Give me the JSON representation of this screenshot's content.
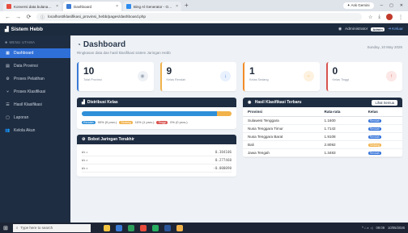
{
  "browser": {
    "tabs": [
      {
        "label": "Konversi data bulanan ke tahu",
        "fav_color": "#e74c3c",
        "active": false
      },
      {
        "label": "Dashboard",
        "fav_color": "#3a7bd5",
        "active": true
      },
      {
        "label": "Bing Al Generator - Online Harr",
        "fav_color": "#2d8cf0",
        "active": false
      }
    ],
    "ask_gemini": "Ask Gemini",
    "url": "localhost/klasifikasi_provinsi_hebb/pages/dashboard.php"
  },
  "app": {
    "brand": "Sistem Hebb",
    "user_name": "Administrator",
    "role_badge": "Admin",
    "logout": "Keluar"
  },
  "sidebar": {
    "heading": "MENU UTAMA",
    "items": [
      {
        "label": "Dashboard",
        "icon": "grid-icon",
        "glyph": "▦",
        "active": true
      },
      {
        "label": "Data Provinsi",
        "icon": "table-icon",
        "glyph": "▤"
      },
      {
        "label": "Proses Pelatihan",
        "icon": "cog-icon",
        "glyph": "⚙"
      },
      {
        "label": "Proses Klasifikasi",
        "icon": "branch-icon",
        "glyph": "⑂"
      },
      {
        "label": "Hasil Klasifikasi",
        "icon": "list-icon",
        "glyph": "☰"
      },
      {
        "label": "Laporan",
        "icon": "file-icon",
        "glyph": "▢"
      },
      {
        "label": "Kelola Akun",
        "icon": "users-icon",
        "glyph": "👥"
      }
    ]
  },
  "main": {
    "title": "Dashboard",
    "subtitle": "Ringkasan data dan hasil klasifikasi sistem Jaringan Hebb",
    "date": "Sunday, 10 May 2026",
    "stats": [
      {
        "value": "10",
        "label": "Total Provinsi",
        "icon": "map-pin-icon",
        "glyph": "◉",
        "accent": "#3a7bd5",
        "icon_bg": "#eef1f5",
        "icon_fg": "#9aa5b4"
      },
      {
        "value": "9",
        "label": "Kelas Rendah",
        "icon": "arrow-down-icon",
        "glyph": "↓",
        "accent": "#f1b24a",
        "icon_bg": "#e8f1fd",
        "icon_fg": "#3a7bd5"
      },
      {
        "value": "1",
        "label": "Kelas Sedang",
        "icon": "minus-icon",
        "glyph": "−",
        "accent": "#f28c28",
        "icon_bg": "#fdf1df",
        "icon_fg": "#f1b24a"
      },
      {
        "value": "0",
        "label": "Kelas Tinggi",
        "icon": "arrow-up-icon",
        "glyph": "↑",
        "accent": "#d9534f",
        "icon_bg": "#fbe7e6",
        "icon_fg": "#d9534f"
      }
    ]
  },
  "distribution": {
    "title": "Distribusi Kelas",
    "segments": [
      {
        "name": "Rendah",
        "percent": 90,
        "text": "90% (9 prov.)",
        "color": "#2f8fd8"
      },
      {
        "name": "Sedang",
        "percent": 10,
        "text": "10% (1 prov.)",
        "color": "#f1b24a"
      },
      {
        "name": "Tinggi",
        "percent": 0,
        "text": "0% (0 prov.)",
        "color": "#d9534f"
      }
    ]
  },
  "weights": {
    "title": "Bobot Jaringan Terakhir",
    "rows": [
      {
        "label": "w₁₁",
        "value": "0.384106"
      },
      {
        "label": "w₁₂",
        "value": "0.277460"
      },
      {
        "label": "w₁₃",
        "value": "-0.000090"
      }
    ]
  },
  "results": {
    "title": "Hasil Klasifikasi Terbaru",
    "view_all": "Lihat Semua",
    "columns": [
      "Provinsi",
      "Rata-rata",
      "Kelas"
    ],
    "rows": [
      {
        "province": "Sulawesi Tenggara",
        "avg": "1.1600",
        "class": "Rendah",
        "color": "#2f6fd8"
      },
      {
        "province": "Nusa Tenggara Timur",
        "avg": "1.7142",
        "class": "Rendah",
        "color": "#2f6fd8"
      },
      {
        "province": "Nusa Tenggara Barat",
        "avg": "1.9108",
        "class": "Rendah",
        "color": "#2f6fd8"
      },
      {
        "province": "Bali",
        "avg": "2.8092",
        "class": "Sedang",
        "color": "#f1b24a"
      },
      {
        "province": "Jawa Tengah",
        "avg": "1.3483",
        "class": "Rendah",
        "color": "#2f6fd8"
      }
    ]
  },
  "taskbar": {
    "search_placeholder": "Type here to search",
    "time": "09:09",
    "date": "10/05/2026"
  }
}
